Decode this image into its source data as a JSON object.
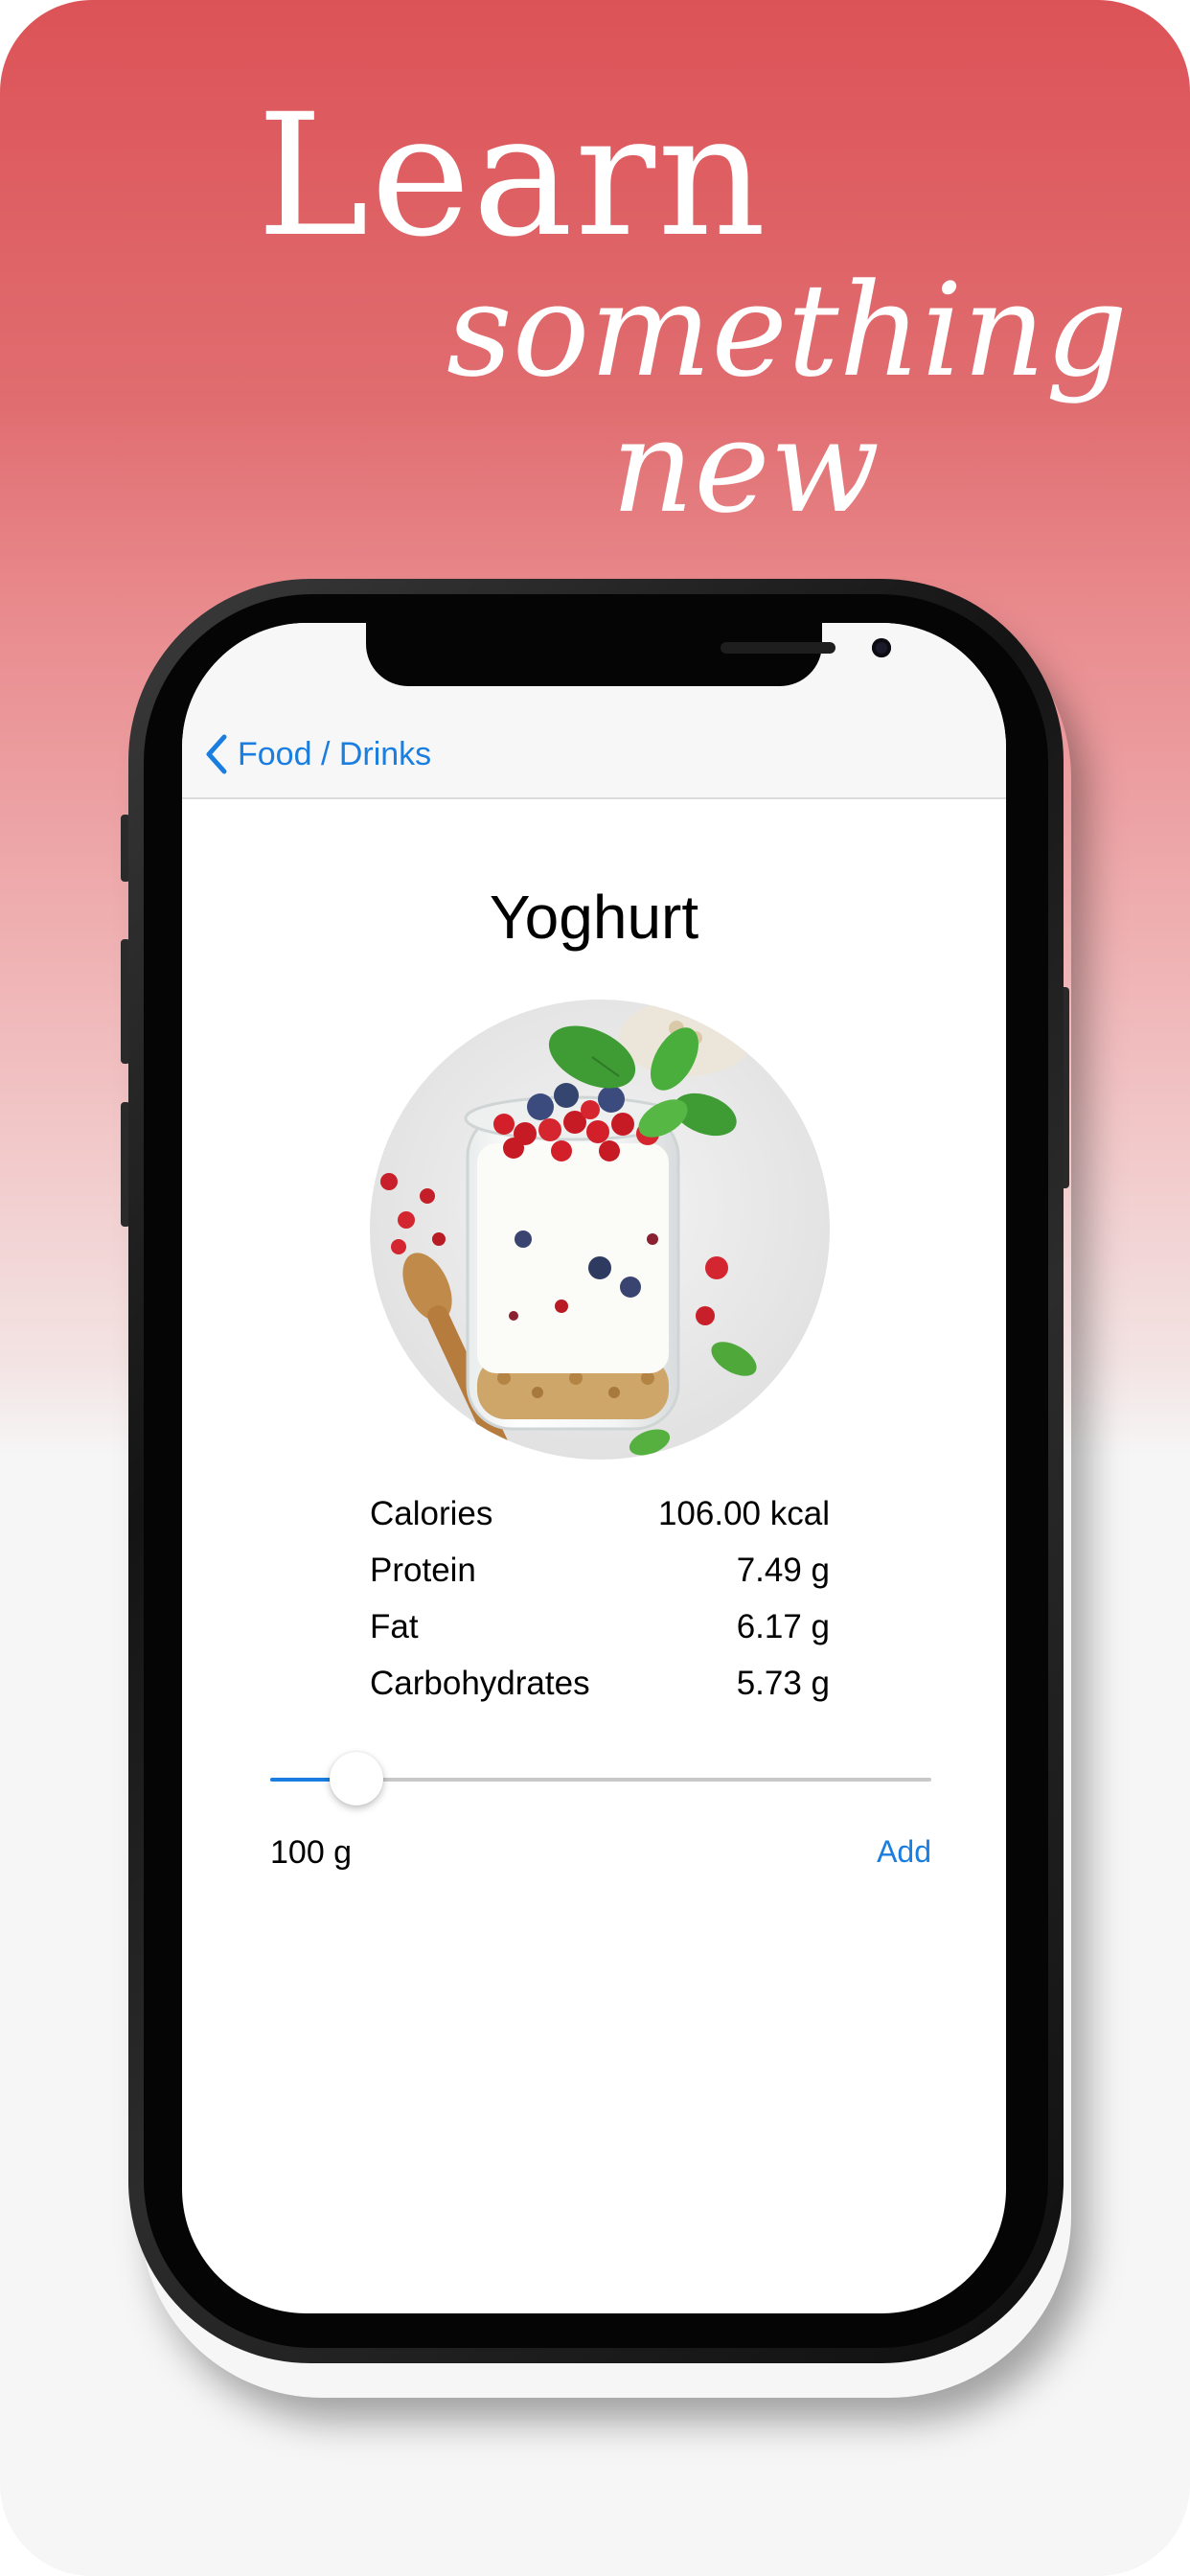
{
  "banner": {
    "line1": "Learn",
    "line2": "something",
    "line3": "new"
  },
  "nav": {
    "back_label": "Food / Drinks"
  },
  "food": {
    "title": "Yoghurt",
    "image": "yoghurt-jar-with-berries"
  },
  "nutrients": [
    {
      "label": "Calories",
      "value": "106.00 kcal"
    },
    {
      "label": "Protein",
      "value": "7.49 g"
    },
    {
      "label": "Fat",
      "value": "6.17 g"
    },
    {
      "label": "Carbohydrates",
      "value": "5.73 g"
    }
  ],
  "portion": {
    "amount_label": "100 g",
    "slider_fraction": 0.13,
    "add_label": "Add"
  },
  "colors": {
    "accent": "#1a7ee0",
    "banner_top": "#dc5357",
    "background": "#f6f6f6"
  }
}
